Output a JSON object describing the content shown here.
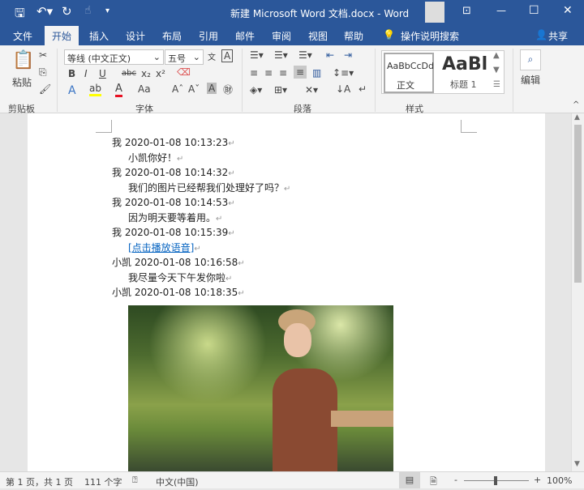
{
  "title_bar": {
    "title": "新建 Microsoft Word 文档.docx  -  Word",
    "icons": [
      "save-icon",
      "undo-icon",
      "redo-icon",
      "touch-mode-icon",
      "customize-icon",
      "ribbon-display-icon",
      "minimize-icon",
      "maximize-icon",
      "close-icon"
    ]
  },
  "tabs": [
    {
      "label": "文件"
    },
    {
      "label": "开始"
    },
    {
      "label": "插入"
    },
    {
      "label": "设计"
    },
    {
      "label": "布局"
    },
    {
      "label": "引用"
    },
    {
      "label": "邮件"
    },
    {
      "label": "审阅"
    },
    {
      "label": "视图"
    },
    {
      "label": "帮助"
    }
  ],
  "tell_me": "操作说明搜索",
  "share": "共享",
  "ribbon": {
    "clipboard": {
      "label": "剪贴板",
      "paste": "粘贴"
    },
    "font": {
      "label": "字体",
      "font_name": "等线 (中文正文)",
      "font_size": "五号",
      "bold": "B",
      "italic": "I",
      "underline": "U",
      "strike": "abc",
      "sub": "x₂",
      "sup": "x²",
      "case": "Aa",
      "phonetic": "A"
    },
    "paragraph": {
      "label": "段落"
    },
    "styles": {
      "label": "样式",
      "normal_preview": "AaBbCcDd",
      "normal": "正文",
      "heading_preview": "AaBl",
      "heading": "标题 1"
    },
    "editing": {
      "label": "编辑"
    }
  },
  "document": {
    "lines": [
      {
        "text": "我  2020-01-08 10:13:23",
        "indent": false
      },
      {
        "text": "小凯你好！",
        "indent": true
      },
      {
        "text": "我  2020-01-08 10:14:32",
        "indent": false
      },
      {
        "text": "我们的图片已经帮我们处理好了吗？",
        "indent": true
      },
      {
        "text": "我  2020-01-08 10:14:53",
        "indent": false
      },
      {
        "text": "因为明天要等着用。",
        "indent": true
      },
      {
        "text": "我  2020-01-08 10:15:39",
        "indent": false
      },
      {
        "text": "[点击播放语音]",
        "indent": true,
        "link": true
      },
      {
        "text": "小凯  2020-01-08 10:16:58",
        "indent": false
      },
      {
        "text": "我尽量今天下午发你啦",
        "indent": true
      },
      {
        "text": "小凯  2020-01-08 10:18:35",
        "indent": false
      }
    ],
    "paragraph_mark": "↵",
    "link_color": "#0563c1"
  },
  "status": {
    "page": "第 1 页，共 1 页",
    "words": "111 个字",
    "language": "中文(中国)",
    "zoom": "100%",
    "zoom_percent": 100
  },
  "colors": {
    "accent": "#2b579a",
    "highlight": "#ffff00",
    "font_color": "#e81123"
  }
}
